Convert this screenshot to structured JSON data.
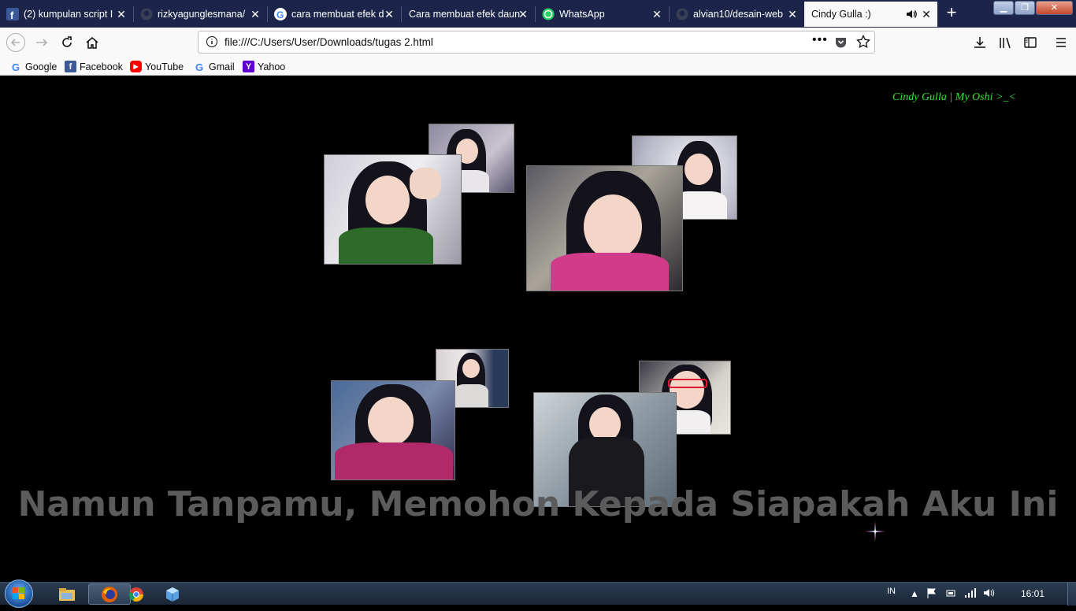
{
  "tabs": [
    {
      "title": "(2) kumpulan script I",
      "icon": "facebook-icon"
    },
    {
      "title": "rizkyagunglesmana/",
      "icon": "github-icon"
    },
    {
      "title": "cara membuat efek d",
      "icon": "google-icon"
    },
    {
      "title": "Cara membuat efek daun",
      "icon": "none"
    },
    {
      "title": "WhatsApp",
      "icon": "whatsapp-icon"
    },
    {
      "title": "alvian10/desain-web",
      "icon": "github-icon"
    },
    {
      "title": "Cindy Gulla :)",
      "icon": "none",
      "active": true,
      "audio": true
    }
  ],
  "address_bar": {
    "url": "file:///C:/Users/User/Downloads/tugas 2.html"
  },
  "bookmarks": [
    {
      "label": "Google",
      "icon": "google-icon",
      "color": "#4285f4"
    },
    {
      "label": "Facebook",
      "icon": "facebook-icon",
      "color": "#3b5998"
    },
    {
      "label": "YouTube",
      "icon": "youtube-icon",
      "color": "#ff0000"
    },
    {
      "label": "Gmail",
      "icon": "google-icon",
      "color": "#4285f4"
    },
    {
      "label": "Yahoo",
      "icon": "yahoo-icon",
      "color": "#5f01d1"
    }
  ],
  "page": {
    "corner_text": "Cindy Gulla | My Oshi >_<",
    "corner_color": "#2ee82e",
    "quote": "Namun Tanpamu, Memohon Kepada Siapakah Aku Ini",
    "quote_color": "#5b5b5b",
    "photos": [
      "photo-girl-small-top",
      "photo-girl-peace-sign",
      "photo-girl-green-outfit",
      "photo-girl-pink-car",
      "photo-girl-small-room",
      "photo-girl-red-glasses",
      "photo-girl-finger-lips",
      "photo-girl-black-dress"
    ]
  },
  "taskbar": {
    "apps": [
      "file-explorer-icon",
      "firefox-icon",
      "chrome-icon",
      "app-box-icon"
    ],
    "active_app": "firefox-icon",
    "language": "IN",
    "clock": "16:01"
  }
}
